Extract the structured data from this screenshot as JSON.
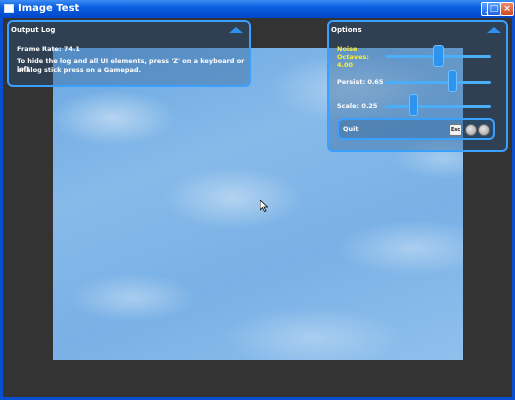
{
  "window": {
    "title": "Image Test",
    "buttons": {
      "minimize": "_",
      "maximize": "□",
      "close": "×"
    }
  },
  "output_log": {
    "title": "Output Log",
    "frame_rate": "Frame Rate: 74.1",
    "hint_line1": "To hide the log and all UI elements, press 'Z' on a keyboard or left",
    "hint_line2": "analog stick press on a Gamepad."
  },
  "options": {
    "title": "Options",
    "noise_label_1": "Noise",
    "noise_label_2": "Octaves:",
    "noise_label_3": "4.00",
    "noise_level": 0.5,
    "persist_label": "Persist: 0.65",
    "persist_level": 0.65,
    "scale_label": "Scale: 0.25",
    "scale_level": 0.25,
    "quit_label": "Quit",
    "esc_key": "Esc"
  },
  "colors": {
    "panel_border": "#3aa0ff",
    "highlight_text": "#ffee33",
    "titlebar": "#0a5fe0"
  },
  "icons": [
    "app-window-icon",
    "mouse-cursor-icon",
    "collapse-arrow-icon",
    "gamepad-button-icon"
  ]
}
